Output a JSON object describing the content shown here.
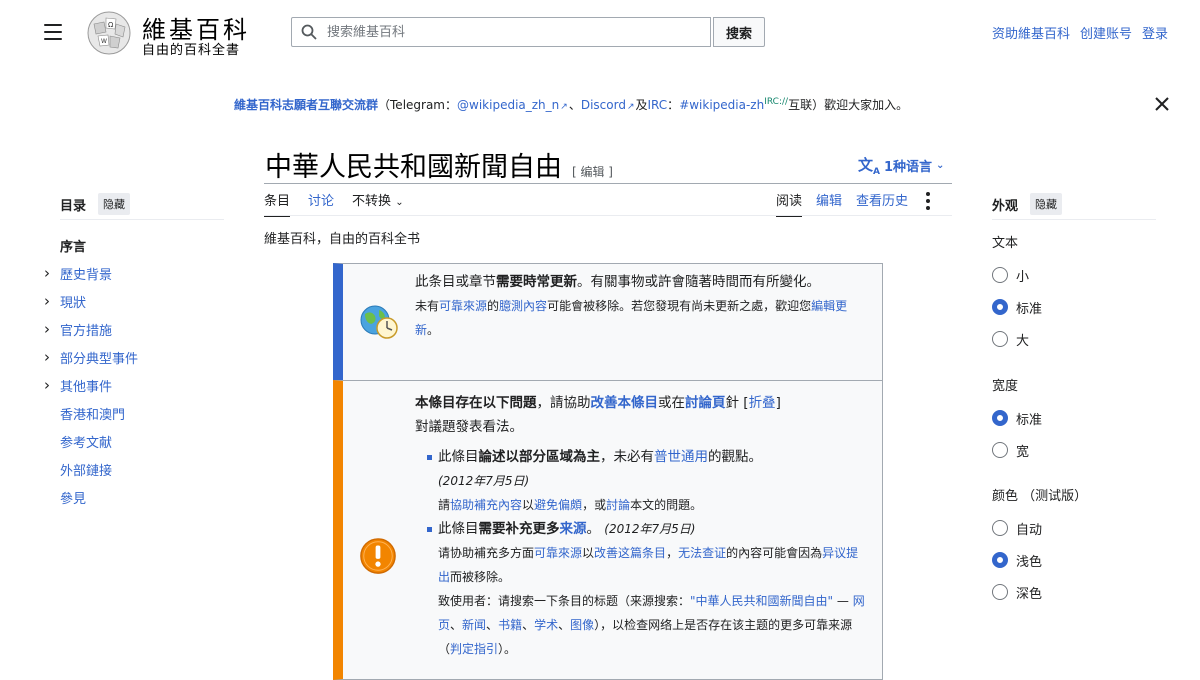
{
  "header": {
    "brand_title": "維基百科",
    "brand_subtitle": "自由的百科全書",
    "search_placeholder": "搜索維基百科",
    "search_button": "搜索",
    "links": [
      "资助維基百科",
      "创建账号",
      "登录"
    ]
  },
  "sitenotice": {
    "group": "維基百科志願者互聯交流群",
    "open_paren": "（Telegram：",
    "tg_handle": "@wikipedia_zh_n",
    "sep1": "、",
    "discord": "Discord",
    "and": "及",
    "irc": "IRC",
    "colon": "：",
    "irc_channel": "#wikipedia-zh",
    "irc_prefix": "IRC://",
    "tail": "互联）歡迎大家加入。"
  },
  "page": {
    "title": "中華人民共和國新聞自由",
    "edit_link": "[ 编辑 ]",
    "language_button": "1种语言",
    "tabs_left": [
      "条目",
      "讨论",
      "不转换"
    ],
    "tabs_right": [
      "阅读",
      "编辑",
      "查看历史"
    ],
    "tagline": "維基百科，自由的百科全书"
  },
  "toc": {
    "title": "目录",
    "hide": "隐藏",
    "items": [
      {
        "label": "序言",
        "expandable": false
      },
      {
        "label": "歷史背景",
        "expandable": true
      },
      {
        "label": "現狀",
        "expandable": true
      },
      {
        "label": "官方措施",
        "expandable": true
      },
      {
        "label": "部分典型事件",
        "expandable": true
      },
      {
        "label": "其他事件",
        "expandable": true
      },
      {
        "label": "香港和澳門",
        "expandable": false
      },
      {
        "label": "参考文献",
        "expandable": false
      },
      {
        "label": "外部鏈接",
        "expandable": false
      },
      {
        "label": "參見",
        "expandable": false
      }
    ]
  },
  "appearance": {
    "title": "外观",
    "hide": "隐藏",
    "text_label": "文本",
    "text_options": [
      "小",
      "标准",
      "大"
    ],
    "text_selected": "标准",
    "width_label": "宽度",
    "width_options": [
      "标准",
      "宽"
    ],
    "width_selected": "标准",
    "color_label": "颜色 （测试版）",
    "color_options": [
      "自动",
      "浅色",
      "深色"
    ],
    "color_selected": "浅色"
  },
  "notice1": {
    "a": "此条目或章节",
    "b": "需要時常更新",
    "c": "。有關事物或許會隨著時間而有所變化。",
    "d": "未有",
    "d_link": "可靠來源",
    "e": "的",
    "e_link": "臆測內容",
    "f": "可能會被移除。若您發現有尚未更新之處，歡迎您",
    "f_link": "編輯更新",
    "g": "。"
  },
  "notice2": {
    "head_b": "本條目存在以下問題",
    "head_1": "，請協助",
    "head_link1": "改善本條目",
    "head_2": "或在",
    "head_link2": "討論頁",
    "head_3": "針 [",
    "head_link3": "折叠",
    "head_4": "]",
    "head_5": "對議題發表看法。",
    "i1_a": "此條目",
    "i1_b": "論述以部分區域為主",
    "i1_c": "，未必有",
    "i1_link": "普世通用",
    "i1_d": "的觀點。",
    "i1_date": "(2012年7月5日)",
    "i1_e": "請",
    "i1_link2": "協助補充內容",
    "i1_f": "以",
    "i1_link3": "避免偏頗",
    "i1_g": "，或",
    "i1_link4": "討論",
    "i1_h": "本文的問題。",
    "i2_a": "此條目",
    "i2_b": "需要补充更多",
    "i2_link": "来源",
    "i2_c": "。",
    "i2_date": "(2012年7月5日)",
    "i2_d": "请协助補充多方面",
    "i2_link2": "可靠來源",
    "i2_e": "以",
    "i2_link3": "改善这篇条目",
    "i2_f": "，",
    "i2_link4": "无法查证",
    "i2_g": "的內容可能會因為",
    "i2_link5": "异议提出",
    "i2_h": "而被移除。",
    "i2_i": "致使用者：请搜索一下条目的标题（来源搜索：",
    "i2_link6": "\"中華人民共和國新聞自由\"",
    "i2_j": " — ",
    "i2_links": [
      "网页",
      "新闻",
      "书籍",
      "学术",
      "图像"
    ],
    "i2_k": "），以检查网络上是否存在该主题的更多可靠来源（",
    "i2_link7": "判定指引",
    "i2_l": "）。"
  },
  "colors": {
    "accent": "#3366cc",
    "notice_blue": "#3366cc",
    "notice_orange": "#f28500"
  }
}
